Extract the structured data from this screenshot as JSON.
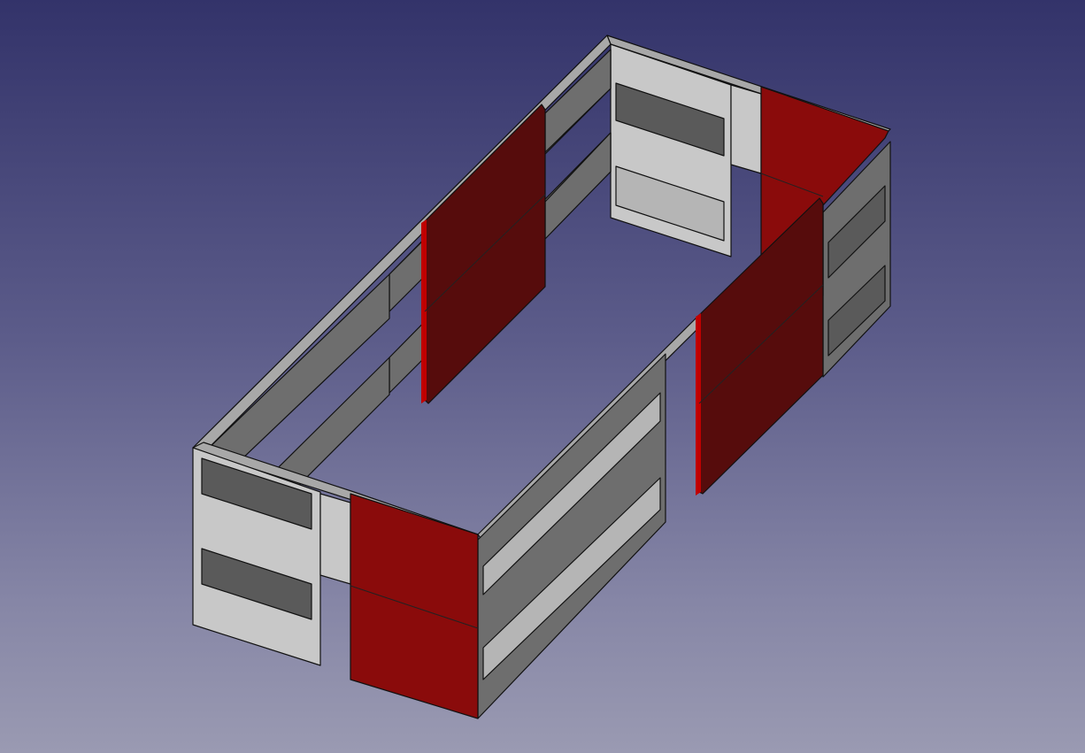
{
  "view": {
    "background_top": "#33336a",
    "background_bottom": "#9a9ab2"
  },
  "model": {
    "wall_color": "#c8c8c8",
    "wall_shade": "#6e6e6e",
    "selected_color": "#8a0b0b"
  }
}
